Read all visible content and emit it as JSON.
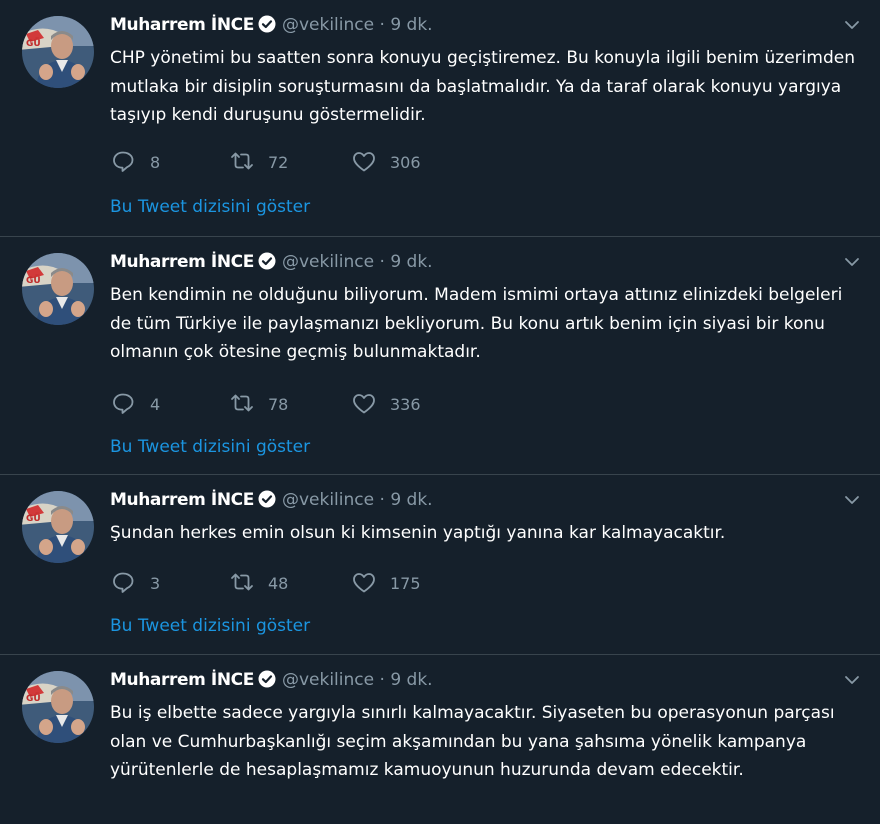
{
  "colors": {
    "background": "#15202b",
    "text": "#ffffff",
    "muted": "#8899a6",
    "link": "#1b95e0",
    "divider": "#38444d"
  },
  "tweets": [
    {
      "name": "Muharrem İNCE",
      "handle": "@vekilince",
      "separator": "·",
      "time": "9 dk.",
      "text": "CHP yönetimi bu saatten sonra konuyu geçiştiremez. Bu konuyla ilgili benim üzerimden mutlaka bir disiplin soruşturmasını da başlatmalıdır. Ya da  taraf olarak konuyu yargıya taşıyıp kendi duruşunu göstermelidir.",
      "replies": "8",
      "retweets": "72",
      "likes": "306",
      "thread_link": "Bu Tweet dizisini göster"
    },
    {
      "name": "Muharrem İNCE",
      "handle": "@vekilince",
      "separator": "·",
      "time": "9 dk.",
      "text": "Ben kendimin ne olduğunu biliyorum. Madem ismimi ortaya attınız elinizdeki belgeleri de tüm Türkiye ile paylaşmanızı bekliyorum.  Bu konu artık benim için siyasi bir konu olmanın çok ötesine geçmiş bulunmaktadır.",
      "replies": "4",
      "retweets": "78",
      "likes": "336",
      "thread_link": "Bu Tweet dizisini göster"
    },
    {
      "name": "Muharrem İNCE",
      "handle": "@vekilince",
      "separator": "·",
      "time": "9 dk.",
      "text": "Şundan herkes emin olsun ki kimsenin yaptığı yanına kar kalmayacaktır.",
      "replies": "3",
      "retweets": "48",
      "likes": "175",
      "thread_link": "Bu Tweet dizisini göster"
    },
    {
      "name": "Muharrem İNCE",
      "handle": "@vekilince",
      "separator": "·",
      "time": "9 dk.",
      "text": "Bu iş elbette sadece yargıyla sınırlı kalmayacaktır. Siyaseten bu operasyonun parçası olan ve Cumhurbaşkanlığı seçim akşamından bu yana şahsıma yönelik kampanya yürütenlerle de hesaplaşmamız kamuoyunun huzurunda devam edecektir."
    }
  ]
}
